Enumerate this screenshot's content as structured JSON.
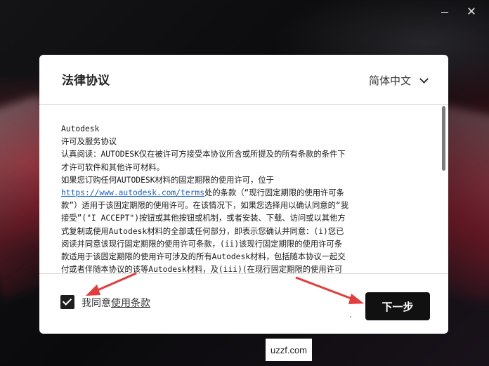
{
  "window": {
    "close_glyph": "✕"
  },
  "dialog": {
    "title": "法律协议",
    "language": "简体中文"
  },
  "terms": {
    "lines": [
      "Autodesk",
      "许可及服务协议",
      "认真阅读：AUTODESK仅在被许可方接受本协议所含或所提及的所有条款的条件下",
      "才许可软件和其他许可材料。",
      "如果您订购任何AUTODESK材料的固定期限的使用许可，位于",
      "__LINK__",
      "款”）适用于该固定期限的使用许可。在该情况下，如果您选择用以确认同意的“我",
      "接受”(\"I ACCEPT\")按钮或其他按钮或机制，或者安装、下载、访问或以其他方",
      "式复制或使用Autodesk材料的全部或任何部分，即表示您确认并同意：(i)您已",
      "阅读并同意该现行固定期限的使用许可条款，(ii)该现行固定期限的使用许可条",
      "款适用于该固定期限的使用许可涉及的所有Autodesk材料，包括随本协议一起交",
      "付或者伴随本协议的该等Autodesk材料，及(iii)(在现行固定期限的使用许可"
    ],
    "link_url": "https://www.autodesk.com/terms",
    "link_suffix": "处的条款（“现行固定期限的使用许可条"
  },
  "footer": {
    "agree_prefix": "我同意",
    "agree_link": "使用条款",
    "next_label": "下一步"
  },
  "watermark": "uzzf.com",
  "colors": {
    "link": "#1a5fc7",
    "arrow": "#e63b3b",
    "button": "#111111"
  }
}
